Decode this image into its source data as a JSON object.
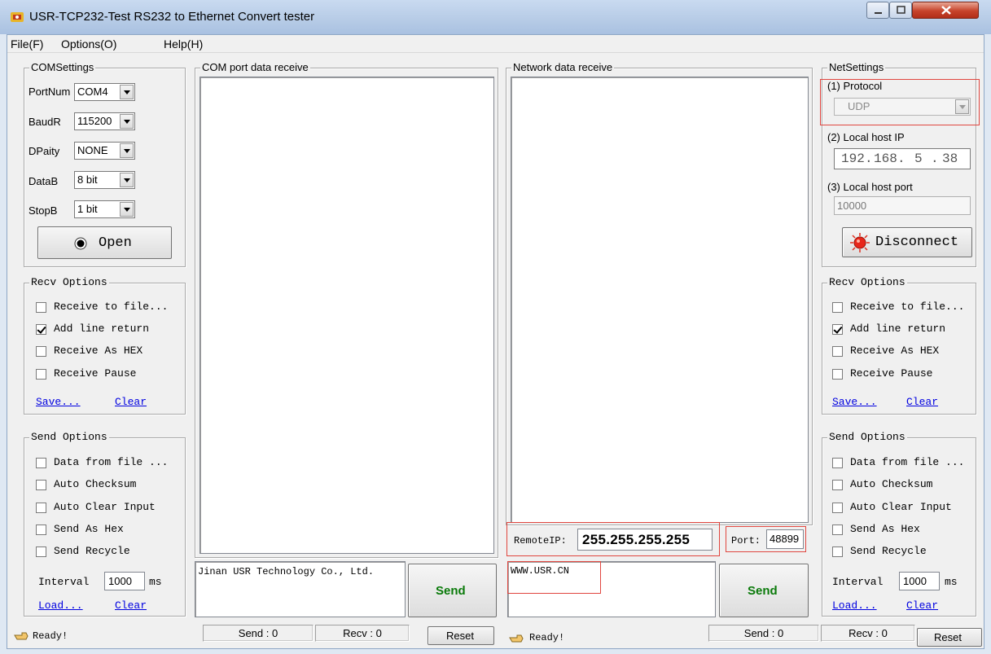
{
  "window": {
    "title": "USR-TCP232-Test  RS232 to Ethernet Convert tester",
    "menu": [
      "File(F)",
      "Options(O)",
      "Help(H)"
    ]
  },
  "com_settings": {
    "title": "COMSettings",
    "port_label": "PortNum",
    "port_value": "COM4",
    "baud_label": "BaudR",
    "baud_value": "115200",
    "parity_label": "DPaity",
    "parity_value": "NONE",
    "data_label": "DataB",
    "data_value": "8 bit",
    "stop_label": "StopB",
    "stop_value": "1 bit",
    "open_label": "Open"
  },
  "left_recv_options": {
    "title": "Recv Options",
    "items": [
      {
        "label": "Receive to file...",
        "checked": false
      },
      {
        "label": "Add line return",
        "checked": true
      },
      {
        "label": "Receive As HEX",
        "checked": false
      },
      {
        "label": "Receive Pause",
        "checked": false
      }
    ],
    "save": "Save...",
    "clear": "Clear"
  },
  "left_send_options": {
    "title": "Send Options",
    "items": [
      {
        "label": "Data from file ...",
        "checked": false
      },
      {
        "label": "Auto Checksum",
        "checked": false
      },
      {
        "label": "Auto Clear Input",
        "checked": false
      },
      {
        "label": "Send As Hex",
        "checked": false
      },
      {
        "label": "Send Recycle",
        "checked": false
      }
    ],
    "interval_label": "Interval",
    "interval_value": "1000",
    "interval_unit": "ms",
    "load": "Load...",
    "clear": "Clear"
  },
  "com_receive": {
    "title": "COM port data receive",
    "send_text": "Jinan USR Technology Co., Ltd.",
    "send_button": "Send"
  },
  "net_receive": {
    "title": "Network data receive",
    "remote_ip_label": "RemoteIP:",
    "remote_ip_value": "255.255.255.255",
    "port_label": "Port:",
    "port_value": "48899",
    "send_text": "WWW.USR.CN",
    "send_button": "Send"
  },
  "net_settings": {
    "title": "NetSettings",
    "protocol_label": "(1) Protocol",
    "protocol_value": "UDP",
    "local_ip_label": "(2) Local host IP",
    "local_ip_octets": [
      "192",
      "168",
      "5",
      "38"
    ],
    "local_port_label": "(3) Local host port",
    "local_port_value": "10000",
    "disconnect_label": "Disconnect"
  },
  "right_recv_options": {
    "title": "Recv Options",
    "items": [
      {
        "label": "Receive to file...",
        "checked": false
      },
      {
        "label": "Add line return",
        "checked": true
      },
      {
        "label": "Receive As HEX",
        "checked": false
      },
      {
        "label": "Receive Pause",
        "checked": false
      }
    ],
    "save": "Save...",
    "clear": "Clear"
  },
  "right_send_options": {
    "title": "Send Options",
    "items": [
      {
        "label": "Data from file ...",
        "checked": false
      },
      {
        "label": "Auto Checksum",
        "checked": false
      },
      {
        "label": "Auto Clear Input",
        "checked": false
      },
      {
        "label": "Send As Hex",
        "checked": false
      },
      {
        "label": "Send Recycle",
        "checked": false
      }
    ],
    "interval_label": "Interval",
    "interval_value": "1000",
    "interval_unit": "ms",
    "load": "Load...",
    "clear": "Clear"
  },
  "status": {
    "left_ready": "Ready!",
    "com_send": "Send : 0",
    "com_recv": "Recv : 0",
    "com_reset": "Reset",
    "net_ready": "Ready!",
    "net_send": "Send : 0",
    "net_recv": "Recv : 0",
    "net_reset": "Reset"
  },
  "colors": {
    "send_button_text": "#0a7a0a",
    "link": "#0000e0",
    "highlight_outline": "#e0463f"
  }
}
